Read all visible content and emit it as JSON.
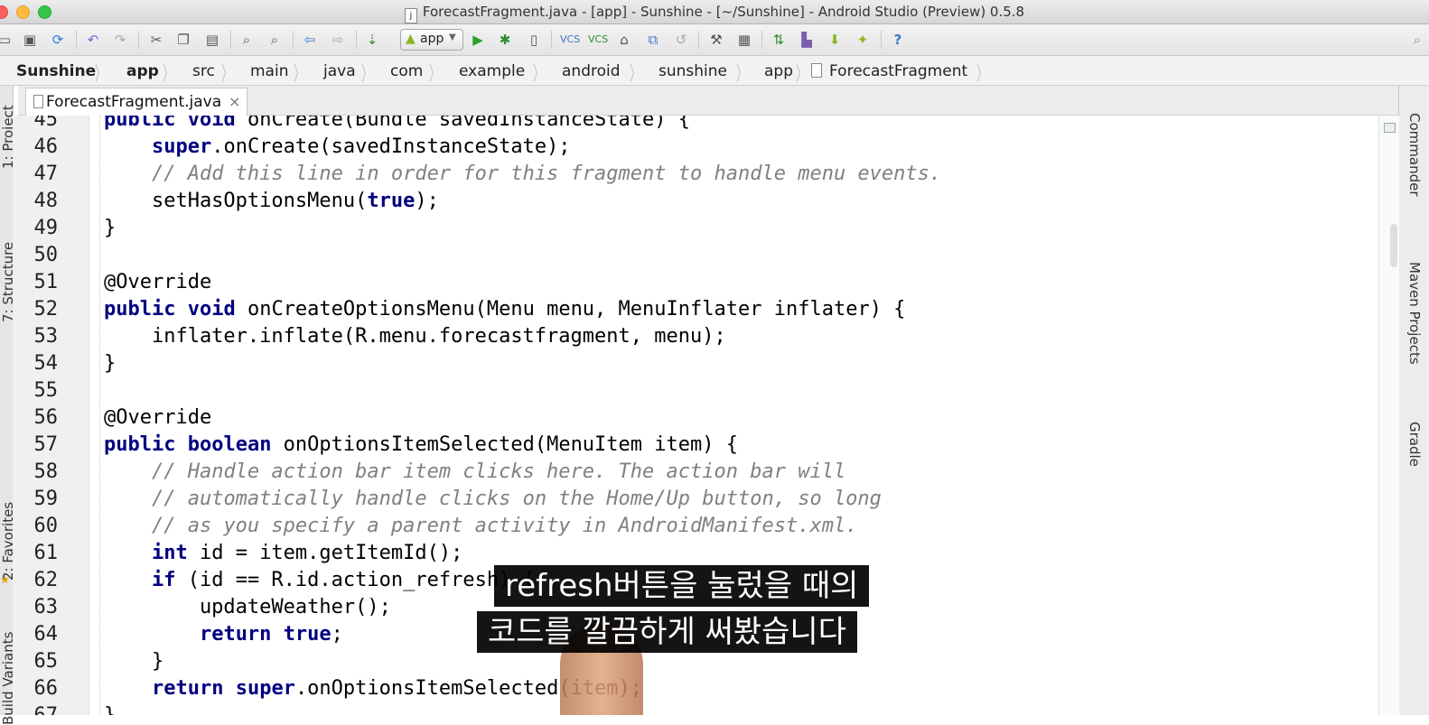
{
  "window": {
    "title": "ForecastFragment.java - [app] - Sunshine - [~/Sunshine] - Android Studio (Preview) 0.5.8"
  },
  "toolbar": {
    "run_config": "app",
    "help": "?"
  },
  "breadcrumbs": [
    "Sunshine",
    "app",
    "src",
    "main",
    "java",
    "com",
    "example",
    "android",
    "sunshine",
    "app",
    "ForecastFragment"
  ],
  "tab": {
    "label": "ForecastFragment.java",
    "close": "×"
  },
  "side_panels": {
    "left": [
      "1: Project",
      "7: Structure",
      "2: Favorites",
      "Build Variants"
    ],
    "right": [
      "Commander",
      "Maven Projects",
      "Gradle"
    ]
  },
  "code_lines": [
    {
      "n": "45",
      "text": "    public void onCreate(Bundle savedInstanceState) {"
    },
    {
      "n": "46",
      "text": "        super.onCreate(savedInstanceState);"
    },
    {
      "n": "47",
      "text": "        // Add this line in order for this fragment to handle menu events."
    },
    {
      "n": "48",
      "text": "        setHasOptionsMenu(true);"
    },
    {
      "n": "49",
      "text": "    }"
    },
    {
      "n": "50",
      "text": ""
    },
    {
      "n": "51",
      "text": "    @Override"
    },
    {
      "n": "52",
      "text": "    public void onCreateOptionsMenu(Menu menu, MenuInflater inflater) {"
    },
    {
      "n": "53",
      "text": "        inflater.inflate(R.menu.forecastfragment, menu);"
    },
    {
      "n": "54",
      "text": "    }"
    },
    {
      "n": "55",
      "text": ""
    },
    {
      "n": "56",
      "text": "    @Override"
    },
    {
      "n": "57",
      "text": "    public boolean onOptionsItemSelected(MenuItem item) {"
    },
    {
      "n": "58",
      "text": "        // Handle action bar item clicks here. The action bar will"
    },
    {
      "n": "59",
      "text": "        // automatically handle clicks on the Home/Up button, so long"
    },
    {
      "n": "60",
      "text": "        // as you specify a parent activity in AndroidManifest.xml."
    },
    {
      "n": "61",
      "text": "        int id = item.getItemId();"
    },
    {
      "n": "62",
      "text": "        if (id == R.id.action_refresh) {"
    },
    {
      "n": "63",
      "text": "            updateWeather();"
    },
    {
      "n": "64",
      "text": "            return true;"
    },
    {
      "n": "65",
      "text": "        }"
    },
    {
      "n": "66",
      "text": "        return super.onOptionsItemSelected(item);"
    },
    {
      "n": "67",
      "text": "    }"
    }
  ],
  "subtitles": {
    "line1": "refresh버튼을 눌렀을 때의",
    "line2": "코드를 깔끔하게 써봤습니다"
  }
}
